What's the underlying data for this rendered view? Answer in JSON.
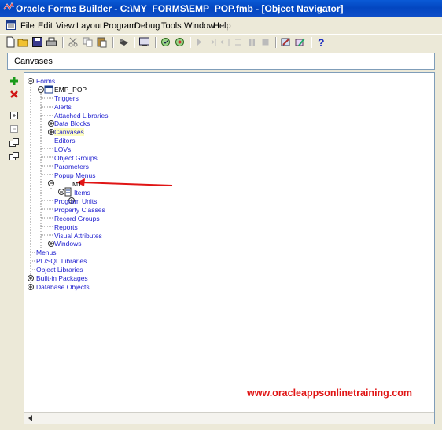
{
  "window": {
    "title": "Oracle Forms Builder - C:\\MY_FORMS\\EMP_POP.fmb - [Object Navigator]"
  },
  "menu": [
    "File",
    "Edit",
    "View",
    "Layout",
    "Program",
    "Debug",
    "Tools",
    "Window",
    "Help"
  ],
  "toolbar_icons": [
    "new-icon",
    "open-icon",
    "save-icon",
    "print-icon",
    "cut-icon",
    "copy-icon",
    "paste-icon",
    "connect-icon",
    "run-icon",
    "compile-icon",
    "debug-icon",
    "step-into-icon",
    "step-over-icon",
    "step-out-icon",
    "pause-icon",
    "stop-icon",
    "wizard-icon",
    "builder-icon",
    "help-icon"
  ],
  "context": {
    "label": "Canvases"
  },
  "side_toolbar": [
    "create-icon",
    "delete-icon",
    "expand-icon",
    "collapse-icon",
    "expand-all-icon",
    "collapse-all-icon"
  ],
  "tree": {
    "forms": "Forms",
    "emp_pop": "EMP_POP",
    "triggers": "Triggers",
    "alerts": "Alerts",
    "attached_libraries": "Attached Libraries",
    "data_blocks": "Data Blocks",
    "canvases": "Canvases",
    "editors": "Editors",
    "lovs": "LOVs",
    "object_groups": "Object Groups",
    "parameters": "Parameters",
    "popup_menus": "Popup Menus",
    "m1": "M1",
    "items": "Items",
    "program_units": "Program Units",
    "property_classes": "Property Classes",
    "record_groups": "Record Groups",
    "reports": "Reports",
    "visual_attributes": "Visual Attributes",
    "windows": "Windows",
    "menus": "Menus",
    "plsql_libraries": "PL/SQL Libraries",
    "object_libraries": "Object Libraries",
    "built_in_packages": "Built-in Packages",
    "database_objects": "Database Objects"
  },
  "watermark": "www.oracleappsonlinetraining.com",
  "colors": {
    "annotation_arrow": "#e01515",
    "tree_text": "#1f1fcf",
    "highlight": "#ffffc0"
  }
}
